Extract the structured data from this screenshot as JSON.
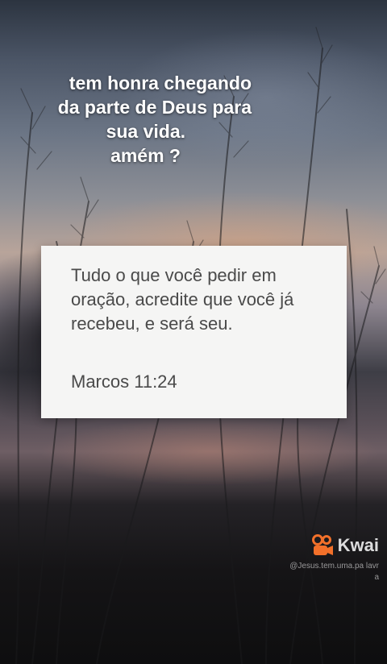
{
  "caption": {
    "lines": [
      "tem honra chegando",
      "da parte de Deus para",
      "sua vida.",
      "amém ?"
    ]
  },
  "verse": {
    "text": "Tudo o que você pedir em oração, acredite que você já recebeu, e será seu.",
    "reference": "Marcos 11:24"
  },
  "watermark": {
    "brand": "Kwai",
    "handle": "@Jesus.tem.uma.pa lavra",
    "logo_icon": "kwai-logo-icon",
    "logo_color": "#f2702a"
  },
  "colors": {
    "card_background": "#f5f5f4",
    "card_text": "#4a4a4a",
    "caption_text": "#ffffff"
  }
}
